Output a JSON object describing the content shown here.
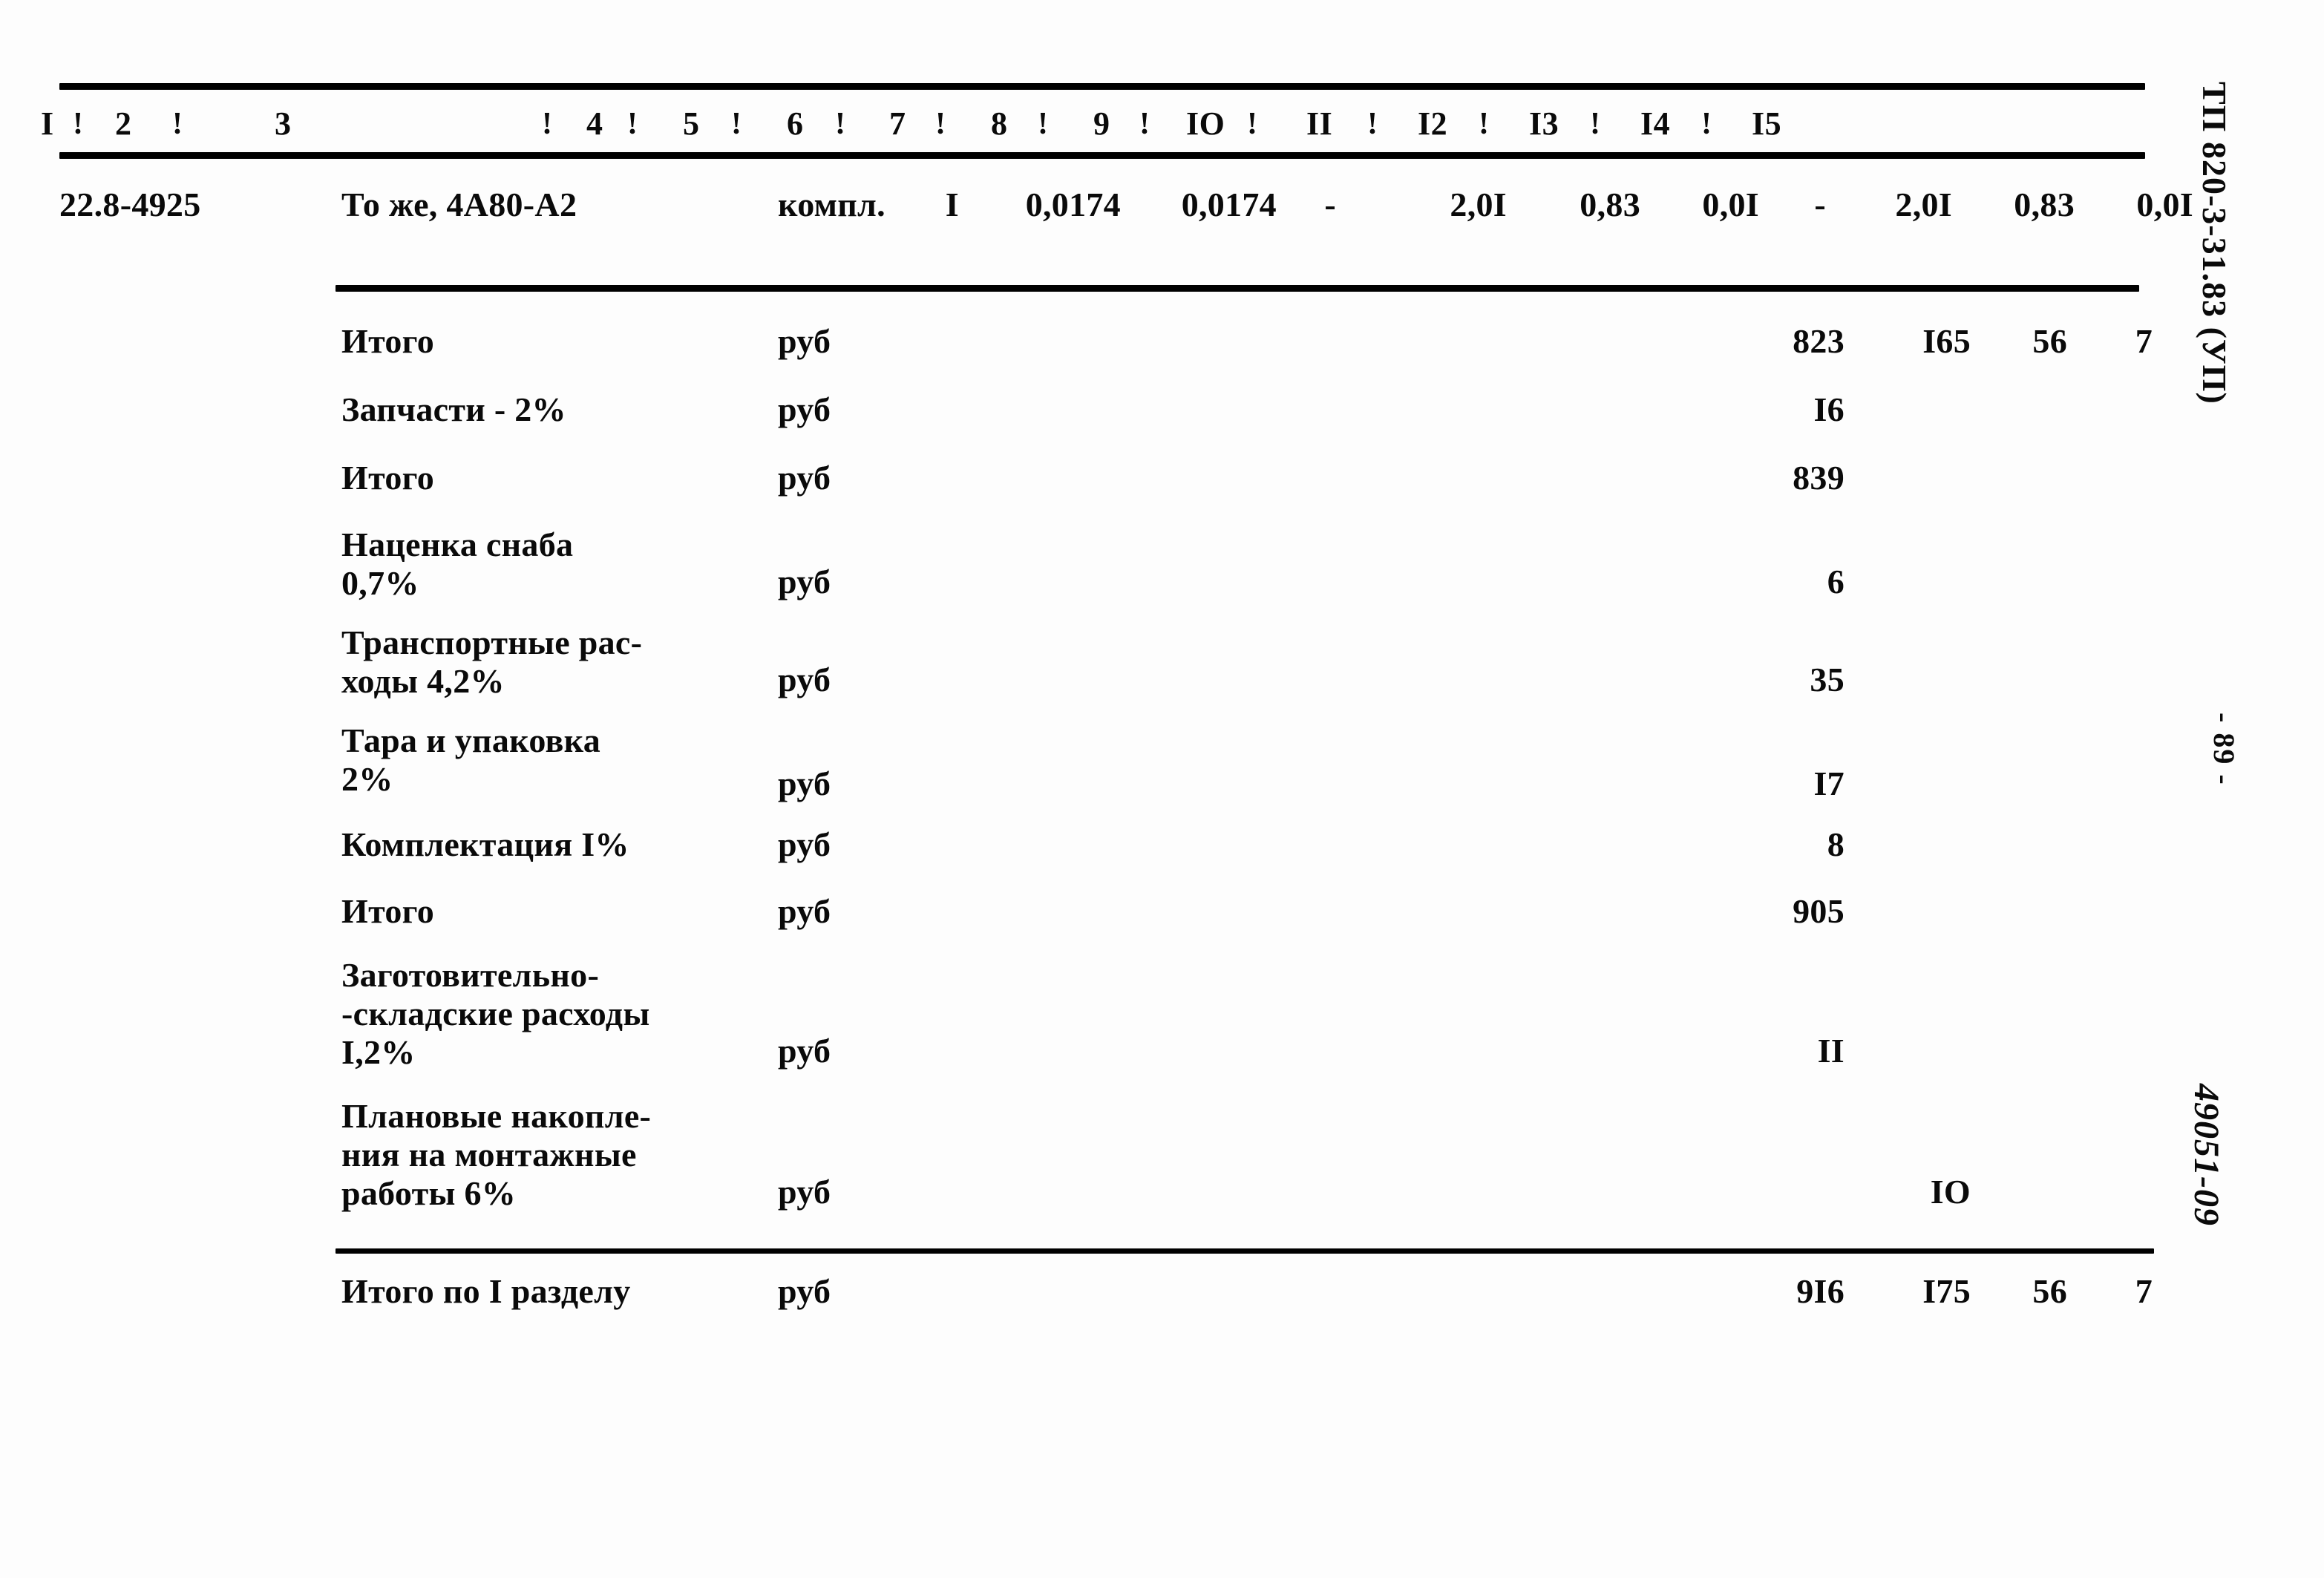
{
  "document": {
    "doc_code": "ТП 820-3-31.83 (УП)",
    "page_number": "- 89 -",
    "sheet_code": "49051-09"
  },
  "table": {
    "column_headers": [
      "I",
      "2",
      "3",
      "4",
      "5",
      "6",
      "7",
      "8",
      "9",
      "IO",
      "II",
      "I2",
      "I3",
      "I4",
      "I5"
    ],
    "column_separator": "!",
    "item_row": {
      "code": "22.8-4925",
      "name": "То же, 4А80-А2",
      "unit": "компл.",
      "qty": "I",
      "v6": "0,0174",
      "v7": "0,0174",
      "v8": "-",
      "v9": "2,0I",
      "v10": "0,83",
      "v11": "0,0I",
      "v12": "-",
      "v13": "2,0I",
      "v14": "0,83",
      "v15": "0,0I"
    },
    "summary_rows": [
      {
        "label": "Итого",
        "unit": "руб",
        "c12": "823",
        "c13": "I65",
        "c14": "56",
        "c15": "7"
      },
      {
        "label": "Запчасти - 2%",
        "unit": "руб",
        "c12": "I6",
        "c13": "",
        "c14": "",
        "c15": ""
      },
      {
        "label": "Итого",
        "unit": "руб",
        "c12": "839",
        "c13": "",
        "c14": "",
        "c15": ""
      },
      {
        "label": "Наценка снаба\n  0,7%",
        "unit": "руб",
        "c12": "6",
        "c13": "",
        "c14": "",
        "c15": ""
      },
      {
        "label": "Транспортные рас-\nходы 4,2%",
        "unit": "руб",
        "c12": "35",
        "c13": "",
        "c14": "",
        "c15": ""
      },
      {
        "label": "Тара и упаковка\n2%",
        "unit": "руб",
        "c12": "I7",
        "c13": "",
        "c14": "",
        "c15": ""
      },
      {
        "label": "Комплектация I%",
        "unit": "руб",
        "c12": "8",
        "c13": "",
        "c14": "",
        "c15": ""
      },
      {
        "label": "Итого",
        "unit": "руб",
        "c12": "905",
        "c13": "",
        "c14": "",
        "c15": ""
      },
      {
        "label": "Заготовительно-\n-складские расходы\nI,2%",
        "unit": "руб",
        "c12": "II",
        "c13": "",
        "c14": "",
        "c15": ""
      },
      {
        "label": "Плановые накопле-\nния на монтажные\nработы 6%",
        "unit": "руб",
        "c12": "",
        "c13": "IO",
        "c14": "",
        "c15": ""
      }
    ],
    "total_row": {
      "label": "Итого по I разделу",
      "unit": "руб",
      "c12": "9I6",
      "c13": "I75",
      "c14": "56",
      "c15": "7"
    }
  }
}
